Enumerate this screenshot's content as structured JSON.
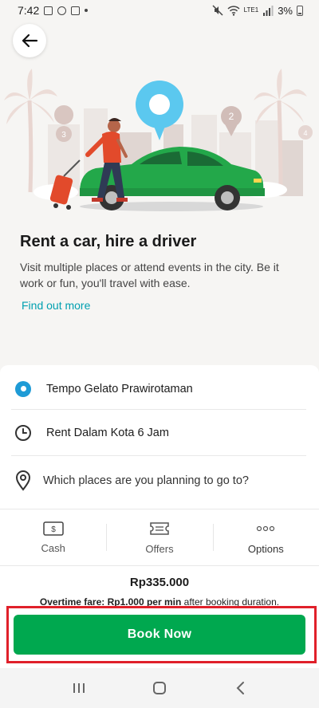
{
  "status_bar": {
    "time": "7:42",
    "battery": "3%",
    "network": "LTE1"
  },
  "hero": {
    "pin_numbers": [
      "3",
      "2",
      "4"
    ],
    "colors": {
      "car": "#23a84a",
      "pin": "#5bc8ef",
      "accent": "#e24a2b"
    }
  },
  "intro": {
    "title": "Rent a car, hire a driver",
    "description": "Visit multiple places or attend events in the city. Be it work or fun, you'll travel with ease.",
    "find_more": "Find out more"
  },
  "booking": {
    "pickup": "Tempo Gelato Prawirotaman",
    "package": "Rent Dalam Kota 6 Jam",
    "destination_placeholder": "Which places are you planning to go to?",
    "options": [
      {
        "label": "Cash",
        "icon": "cash-icon"
      },
      {
        "label": "Offers",
        "icon": "ticket-icon"
      },
      {
        "label": "Options",
        "icon": "more-dots-icon"
      }
    ],
    "price": "Rp335.000",
    "overtime_label": "Overtime fare: Rp1.000 per min",
    "overtime_suffix": "after booking duration.",
    "book_button": "Book Now"
  },
  "colors": {
    "primary_green": "#00a84f",
    "link": "#00a0b0",
    "highlight_frame": "#e0202a",
    "pickup_dot": "#1e9bd6"
  }
}
